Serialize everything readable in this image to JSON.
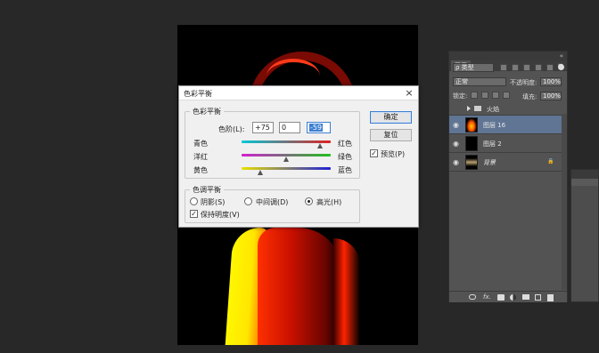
{
  "dialog": {
    "title": "色彩平衡",
    "close_glyph": "×",
    "balance_group_label": "色彩平衡",
    "levels_label": "色阶(L):",
    "levels_values": [
      "+75",
      "0",
      "-59"
    ],
    "sliders": [
      {
        "left": "青色",
        "right": "红色",
        "value": 75
      },
      {
        "left": "洋红",
        "right": "绿色",
        "value": 0
      },
      {
        "left": "黄色",
        "right": "蓝色",
        "value": -59
      }
    ],
    "tone_group_label": "色调平衡",
    "tone_options": [
      {
        "label": "阴影(S)",
        "selected": false
      },
      {
        "label": "中间调(D)",
        "selected": false
      },
      {
        "label": "高光(H)",
        "selected": true
      }
    ],
    "preserve_luminosity_label": "保持明度(V)",
    "preserve_luminosity_checked": true,
    "ok_label": "确定",
    "reset_label": "复位",
    "preview_label": "预览(P)",
    "preview_checked": true,
    "check_glyph": "✓"
  },
  "layers_panel": {
    "collapse_glyph": "«",
    "menu_glyph": "≡",
    "tab_label": "图层",
    "filter_kind": "ρ 类型",
    "blend_mode": "正常",
    "opacity_label": "不透明度:",
    "opacity_value": "100%",
    "lock_label": "锁定:",
    "fill_label": "填充:",
    "fill_value": "100%",
    "group_name": "火焰",
    "eye_glyph": "◉",
    "lock_glyph": "🔒",
    "layers": [
      {
        "name": "图层 16",
        "selected": true
      },
      {
        "name": "图层 2",
        "selected": false
      },
      {
        "name": "背景",
        "selected": false
      }
    ],
    "bottom_icons": [
      "link-icon",
      "fx-icon",
      "mask-icon",
      "adjustment-icon",
      "folder-icon",
      "new-layer-icon",
      "trash-icon"
    ],
    "fx_label": "fx."
  },
  "colors": {
    "app_bg": "#282828",
    "panel_bg": "#535353",
    "selected_layer": "#5f7593",
    "dialog_accent": "#3c7fd1"
  }
}
